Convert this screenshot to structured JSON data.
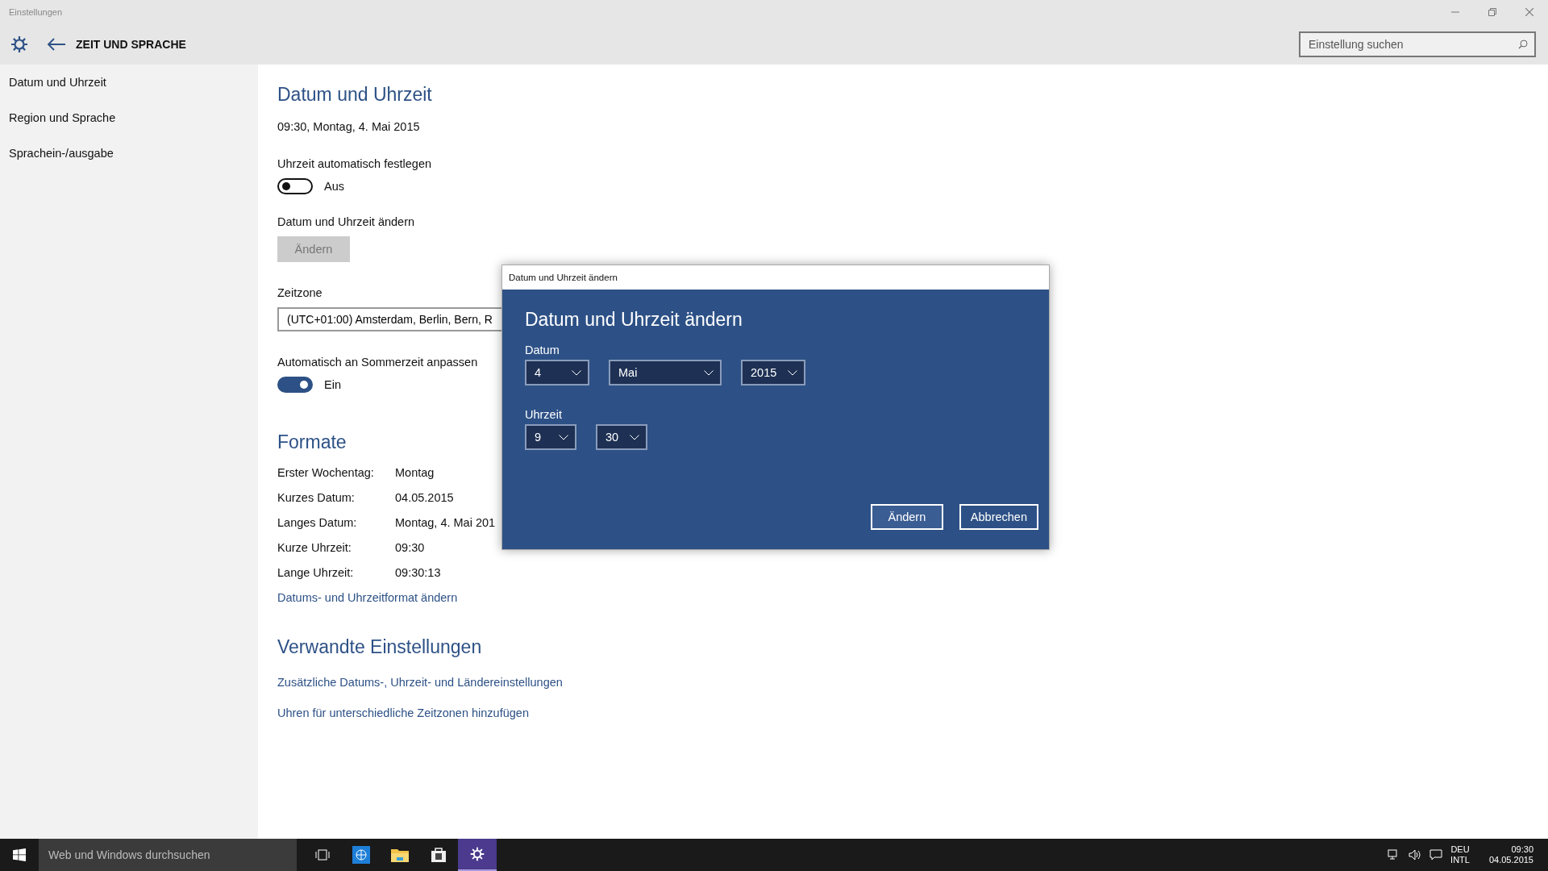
{
  "window": {
    "title": "Einstellungen"
  },
  "header": {
    "title": "ZEIT UND SPRACHE",
    "search_placeholder": "Einstellung suchen"
  },
  "sidebar": {
    "items": [
      "Datum und Uhrzeit",
      "Region und Sprache",
      "Sprachein-/ausgabe"
    ]
  },
  "content": {
    "heading": "Datum und Uhrzeit",
    "current": "09:30, Montag, 4. Mai 2015",
    "toggles": [
      {
        "label": "Uhrzeit automatisch festlegen",
        "on": false,
        "state_text": "Aus"
      }
    ],
    "change": {
      "label": "Datum und Uhrzeit ändern",
      "button": "Ändern",
      "disabled": true
    },
    "zone": {
      "label": "Zeitzone",
      "value": "(UTC+01:00) Amsterdam, Berlin, Bern, R"
    },
    "dst": {
      "label": "Automatisch an Sommerzeit anpassen",
      "on": true,
      "state_text": "Ein"
    },
    "formats": {
      "heading": "Formate",
      "rows": [
        {
          "label": "Erster Wochentag:",
          "value": "Montag"
        },
        {
          "label": "Kurzes Datum:",
          "value": "04.05.2015"
        },
        {
          "label": "Langes Datum:",
          "value": "Montag, 4. Mai 201"
        },
        {
          "label": "Kurze Uhrzeit:",
          "value": "09:30"
        },
        {
          "label": "Lange Uhrzeit:",
          "value": "09:30:13"
        }
      ],
      "link": "Datums- und Uhrzeitformat ändern"
    },
    "related": {
      "heading": "Verwandte Einstellungen",
      "links": [
        "Zusätzliche Datums-, Uhrzeit- und Ländereinstellungen",
        "Uhren für unterschiedliche Zeitzonen hinzufügen"
      ]
    }
  },
  "dialog": {
    "title": "Datum und Uhrzeit ändern",
    "heading": "Datum und Uhrzeit ändern",
    "date_label": "Datum",
    "date_fields": [
      "4",
      "Mai",
      "2015"
    ],
    "time_label": "Uhrzeit",
    "time_fields": [
      "9",
      "30"
    ],
    "buttons": [
      "Ändern",
      "Abbrechen"
    ]
  },
  "taskbar": {
    "search_placeholder": "Web und Windows durchsuchen",
    "apps": [
      {
        "kind": "taskview",
        "selected": false
      },
      {
        "kind": "browser",
        "selected": false
      },
      {
        "kind": "folder",
        "selected": false
      },
      {
        "kind": "store",
        "selected": false
      },
      {
        "kind": "settings",
        "selected": true
      }
    ],
    "tray": {
      "language": "DEU",
      "layout": "INTL",
      "time": "09:30",
      "date": "04.05.2015"
    }
  }
}
